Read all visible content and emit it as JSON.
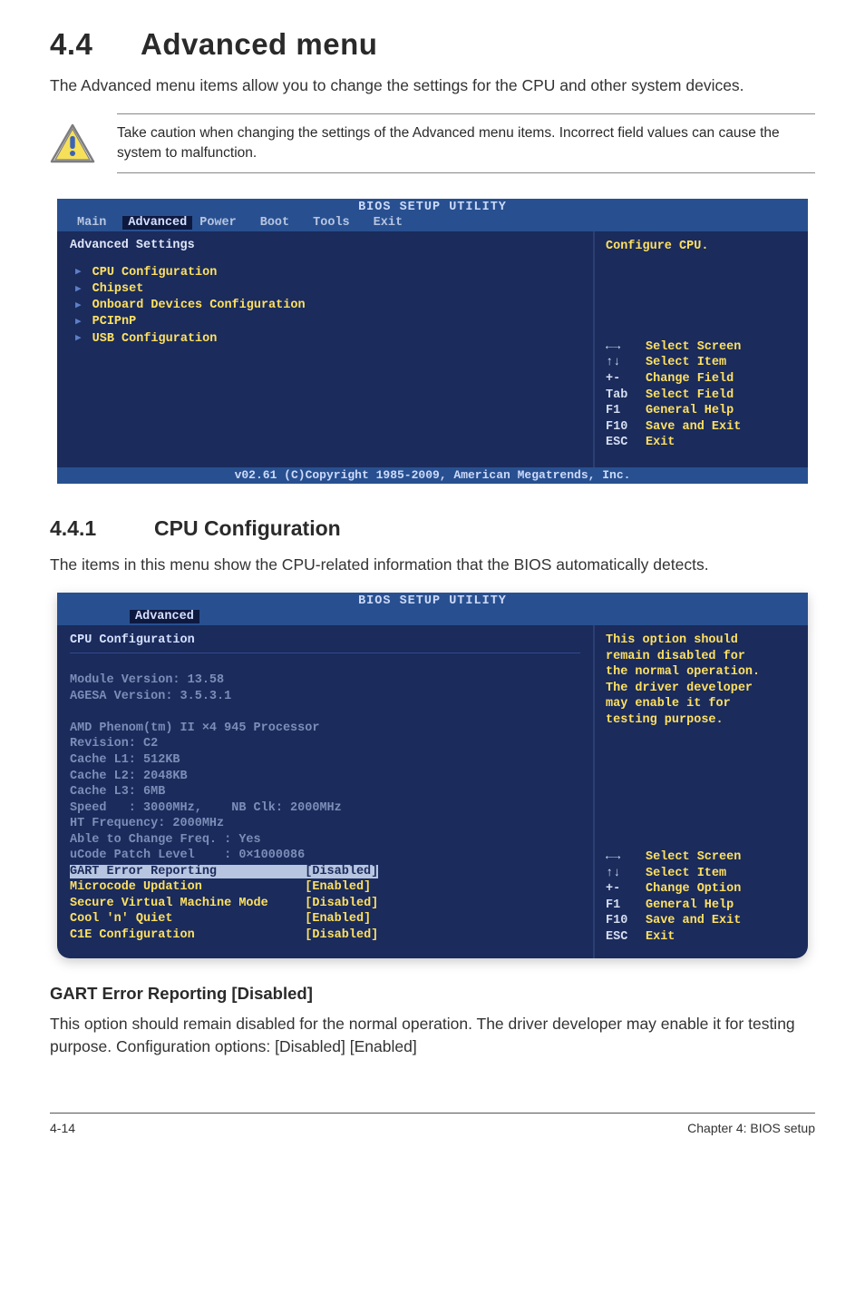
{
  "title_num": "4.4",
  "title_text": "Advanced menu",
  "intro": "The Advanced menu items allow you to change the settings for the CPU and other system devices.",
  "caution": "Take caution when changing the settings of the Advanced menu items. Incorrect field values can cause the system to malfunction.",
  "bios1": {
    "title": "BIOS SETUP UTILITY",
    "tabs": [
      "Main",
      "Advanced",
      "Power",
      "Boot",
      "Tools",
      "Exit"
    ],
    "heading": "Advanced Settings",
    "items": [
      "CPU Configuration",
      "Chipset",
      "Onboard Devices Configuration",
      "PCIPnP",
      "USB Configuration"
    ],
    "right_top": "Configure CPU.",
    "keys": [
      {
        "k": "←→",
        "d": "Select Screen"
      },
      {
        "k": "↑↓",
        "d": "Select Item"
      },
      {
        "k": "+-",
        "d": "Change Field"
      },
      {
        "k": "Tab",
        "d": "Select Field"
      },
      {
        "k": "F1",
        "d": "General Help"
      },
      {
        "k": "F10",
        "d": "Save and Exit"
      },
      {
        "k": "ESC",
        "d": "Exit"
      }
    ],
    "copyright": "v02.61 (C)Copyright 1985-2009, American Megatrends, Inc."
  },
  "sub441_num": "4.4.1",
  "sub441_title": "CPU Configuration",
  "sub441_text": "The items in this menu show the CPU-related information that the BIOS automatically detects.",
  "bios2": {
    "title": "BIOS SETUP UTILITY",
    "tab": "Advanced",
    "heading": "CPU Configuration",
    "lines": {
      "l1": "Module Version: 13.58",
      "l2": "AGESA Version: 3.5.3.1",
      "l3": "AMD Phenom(tm) II ×4 945 Processor",
      "l4": "Revision: C2",
      "l5": "Cache L1: 512KB",
      "l6": "Cache L2: 2048KB",
      "l7": "Cache L3: 6MB",
      "l8": "Speed   : 3000MHz,    NB Clk: 2000MHz",
      "l9": "HT Frequency: 2000MHz",
      "l10": "Able to Change Freq. : Yes",
      "l11": "uCode Patch Level    : 0×1000086",
      "l12": "GART Error Reporting            [Disabled]",
      "l13a": "Microcode Updation",
      "l13b": "[Enabled]",
      "l14a": "Secure Virtual Machine Mode",
      "l14b": "[Disabled]",
      "l15a": "Cool 'n' Quiet",
      "l15b": "[Enabled]",
      "l16a": "C1E Configuration",
      "l16b": "[Disabled]"
    },
    "right_top": "This option should\nremain disabled for\nthe normal operation.\nThe driver developer\nmay enable it for\ntesting purpose.",
    "keys": [
      {
        "k": "←→",
        "d": "Select Screen"
      },
      {
        "k": "↑↓",
        "d": "Select Item"
      },
      {
        "k": "+-",
        "d": "Change Option"
      },
      {
        "k": "F1",
        "d": "General Help"
      },
      {
        "k": "F10",
        "d": "Save and Exit"
      },
      {
        "k": "ESC",
        "d": "Exit"
      }
    ]
  },
  "gart_title": "GART Error Reporting [Disabled]",
  "gart_text": "This option should remain disabled for the normal operation. The driver developer may enable it for testing purpose. Configuration options: [Disabled] [Enabled]",
  "footer_left": "4-14",
  "footer_right": "Chapter 4: BIOS setup"
}
